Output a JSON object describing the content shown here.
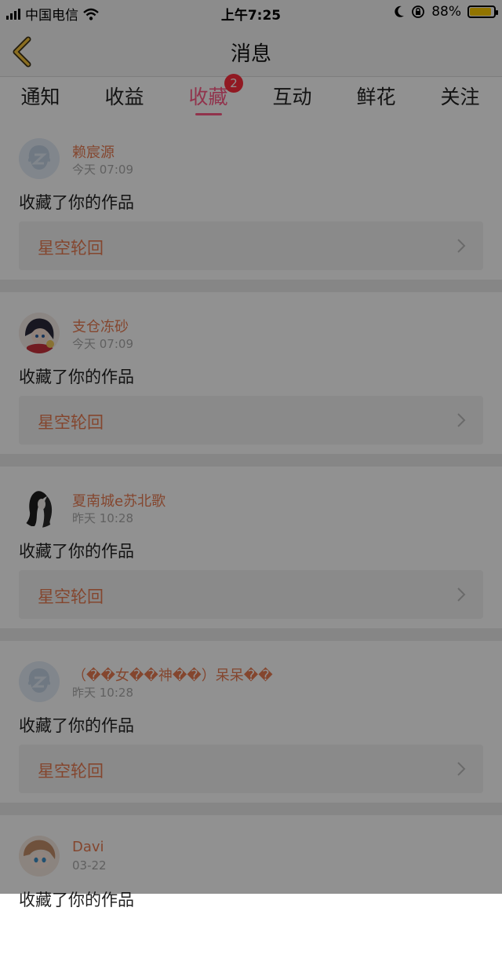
{
  "status_bar": {
    "carrier": "中国电信",
    "time": "上午7:25",
    "battery": "88%",
    "battery_color": "#ffcc00"
  },
  "nav": {
    "title": "消息",
    "back_icon": "chevron-left-icon"
  },
  "tabs": [
    {
      "label": "通知"
    },
    {
      "label": "收益"
    },
    {
      "label": "收藏",
      "badge": "2",
      "active": true
    },
    {
      "label": "互动"
    },
    {
      "label": "鲜花"
    },
    {
      "label": "关注"
    }
  ],
  "accent_color": "#ff5a87",
  "feed": [
    {
      "name": "赖宸源",
      "time": "今天 07:09",
      "action": "收藏了你的作品",
      "work": "星空轮回",
      "avatar": "default-avatar"
    },
    {
      "name": "支仓冻砂",
      "time": "今天 07:09",
      "action": "收藏了你的作品",
      "work": "星空轮回",
      "avatar": "anime-avatar"
    },
    {
      "name": "夏南城e苏北歌",
      "time": "昨天 10:28",
      "action": "收藏了你的作品",
      "work": "星空轮回",
      "avatar": "sketch-avatar"
    },
    {
      "name": "（��女��神��）呆呆��",
      "time": "昨天 10:28",
      "action": "收藏了你的作品",
      "work": "星空轮回",
      "avatar": "default-avatar"
    },
    {
      "name": "Davi",
      "time": "03-22",
      "action": "收藏了你的作品",
      "avatar": "anime-avatar"
    }
  ]
}
